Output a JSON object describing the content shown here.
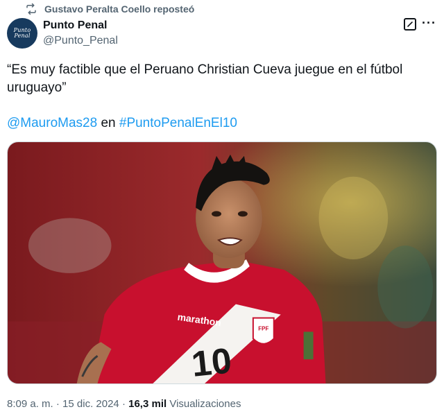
{
  "repost": {
    "text": "Gustavo Peralta Coello reposteó",
    "icon": "repost-icon"
  },
  "author": {
    "name": "Punto Penal",
    "handle": "@Punto_Penal",
    "avatar_line1": "Punto",
    "avatar_line2": "Penal"
  },
  "tweet": {
    "text": "“Es muy factible que el Peruano Christian Cueva juegue en el fútbol uruguayo”",
    "mention": "@MauroMas28",
    "connector": "en",
    "hashtag": "#PuntoPenalEnEl10"
  },
  "media": {
    "jersey_brand": "marathon",
    "jersey_number": "10",
    "crest_text": "FPF"
  },
  "meta": {
    "time": "8:09 a. m.",
    "separator1": "·",
    "date": "15 dic. 2024",
    "separator2": "·",
    "views_count": "16,3 mil",
    "views_label": "Visualizaciones"
  },
  "icons": {
    "grok": "grok-icon",
    "more": "more-icon"
  },
  "colors": {
    "link": "#1d9bf0",
    "secondary_text": "#536471",
    "jersey_red": "#c8102e"
  }
}
